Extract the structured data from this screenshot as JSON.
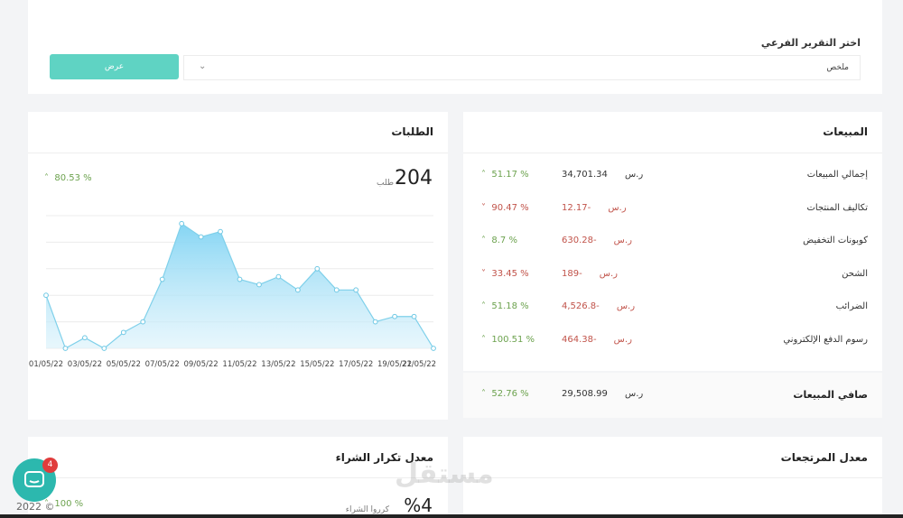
{
  "filter": {
    "label": "اختر التقرير الفرعي",
    "selected": "ملخص",
    "button_label": "عرض"
  },
  "sales": {
    "title": "المبيعات",
    "rows": [
      {
        "label": "إجمالي المبيعات",
        "amount": "34,701.34",
        "currency": "ر.س",
        "change": "51.17 %",
        "trend": "up"
      },
      {
        "label": "تكاليف المنتجات",
        "amount": "-12.17",
        "currency": "ر.س",
        "change": "90.47 %",
        "trend": "down"
      },
      {
        "label": "كوبونات التخفيض",
        "amount": "-630.28",
        "currency": "ر.س",
        "change": "8.7 %",
        "trend": "up"
      },
      {
        "label": "الشحن",
        "amount": "-189",
        "currency": "ر.س",
        "change": "33.45 %",
        "trend": "down"
      },
      {
        "label": "الضرائب",
        "amount": "-4,526.8",
        "currency": "ر.س",
        "change": "51.18 %",
        "trend": "up"
      },
      {
        "label": "رسوم الدفع الإلكتروني",
        "amount": "-464.38",
        "currency": "ر.س",
        "change": "100.51 %",
        "trend": "up"
      }
    ],
    "net": {
      "label": "صافي المبيعات",
      "amount": "29,508.99",
      "currency": "ر.س",
      "change": "52.76 %",
      "trend": "up"
    }
  },
  "orders": {
    "title": "الطلبات",
    "total": "204",
    "unit": "طلب",
    "change": "80.53 %",
    "trend": "up"
  },
  "returns": {
    "title": "معدل المرتجعات"
  },
  "repeat": {
    "title": "معدل تكرار الشراء",
    "value": "%4",
    "unit": "كرروا الشراء",
    "change": "100 %"
  },
  "chat": {
    "badge": "4"
  },
  "footer": {
    "copyright": "2022 ©"
  },
  "watermark": "مستقل",
  "colors": {
    "accent": "#5fd3c3",
    "up": "#6ca24e",
    "down": "#c1534a",
    "chart_line": "#7fd0ea"
  },
  "chart_data": {
    "type": "area",
    "title": "",
    "xlabel": "",
    "ylabel": "",
    "x": [
      "01/05/22",
      "02/05/22",
      "03/05/22",
      "04/05/22",
      "05/05/22",
      "06/05/22",
      "07/05/22",
      "08/05/22",
      "09/05/22",
      "10/05/22",
      "11/05/22",
      "12/05/22",
      "13/05/22",
      "14/05/22",
      "15/05/22",
      "16/05/22",
      "17/05/22",
      "18/05/22",
      "19/05/22",
      "20/05/22",
      "21/05/22"
    ],
    "tick_labels": [
      "01/05/22",
      "03/05/22",
      "05/05/22",
      "07/05/22",
      "09/05/22",
      "11/05/22",
      "13/05/22",
      "15/05/22",
      "17/05/22",
      "19/05/22",
      "21/05/22"
    ],
    "values": [
      20,
      0,
      4,
      0,
      6,
      10,
      26,
      47,
      42,
      44,
      26,
      24,
      27,
      22,
      30,
      22,
      22,
      10,
      12,
      12,
      0
    ],
    "ylim": [
      0,
      50
    ],
    "grid": true
  }
}
